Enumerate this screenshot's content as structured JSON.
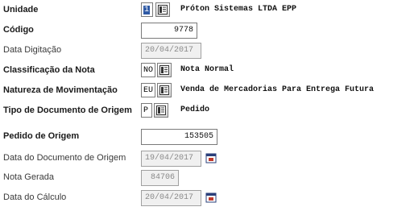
{
  "fields": {
    "unidade": {
      "label": "Unidade",
      "code": "1",
      "description": "Próton Sistemas LTDA EPP"
    },
    "codigo": {
      "label": "Código",
      "value": "9778"
    },
    "data_digitacao": {
      "label": "Data Digitação",
      "value": "20/04/2017"
    },
    "classificacao": {
      "label": "Classificação da Nota",
      "code": "NO",
      "description": "Nota Normal"
    },
    "natureza": {
      "label": "Natureza de Movimentação",
      "code": "EU",
      "description": "Venda de Mercadorias Para Entrega Futura"
    },
    "tipo_documento": {
      "label": "Tipo de Documento de Origem",
      "code": "P",
      "description": "Pedido"
    },
    "pedido_origem": {
      "label": "Pedido de Origem",
      "value": "153505"
    },
    "data_documento_origem": {
      "label": "Data do Documento de Origem",
      "value": "19/04/2017"
    },
    "nota_gerada": {
      "label": "Nota Gerada",
      "value": "84706"
    },
    "data_calculo": {
      "label": "Data do Cálculo",
      "value": "20/04/2017"
    }
  },
  "icons": {
    "lookup": "lookup-list-icon",
    "calendar": "calendar-icon"
  },
  "colors": {
    "selection": "#2f5aa5",
    "readonly_bg": "#f0f0f0",
    "calendar_accent": "#c0392b"
  }
}
